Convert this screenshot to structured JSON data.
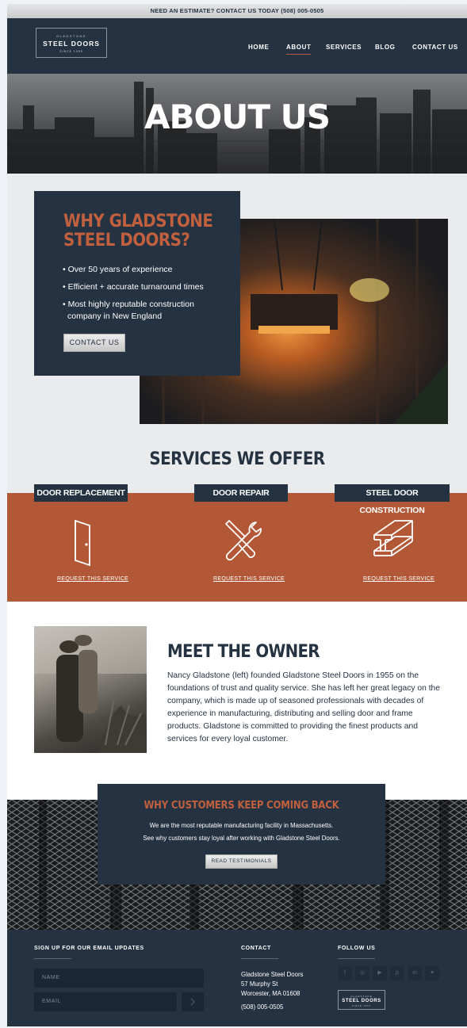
{
  "topbar": {
    "text": "NEED AN ESTIMATE? CONTACT US TODAY (508) 005-0505"
  },
  "logo": {
    "line1": "GLADSTONE",
    "line2": "STEEL DOORS",
    "line3": "SINCE 1955"
  },
  "nav": {
    "items": [
      "HOME",
      "ABOUT",
      "SERVICES",
      "BLOG",
      "CONTACT US"
    ],
    "active": "ABOUT"
  },
  "hero": {
    "title": "ABOUT US"
  },
  "why": {
    "title_line1": "WHY GLADSTONE",
    "title_line2": "STEEL DOORS?",
    "bullets": [
      "• Over 50 years of experience",
      "• Efficient + accurate turnaround times",
      "• Most highly reputable construction",
      "company in New England"
    ],
    "button": "CONTACT US"
  },
  "services": {
    "title": "SERVICES WE OFFER",
    "items": [
      {
        "name": "DOOR REPLACEMENT",
        "link": "REQUEST THIS SERVICE",
        "icon": "door-icon"
      },
      {
        "name": "DOOR REPAIR",
        "link": "REQUEST THIS SERVICE",
        "icon": "wrench-screwdriver-icon"
      },
      {
        "name": "STEEL DOOR CONSTRUCTION",
        "link": "REQUEST THIS SERVICE",
        "icon": "steel-beam-icon"
      }
    ]
  },
  "owner": {
    "title": "MEET THE OWNER",
    "text": "Nancy Gladstone (left) founded Gladstone Steel Doors in 1955 on the foundations of trust and quality service. She has left her great legacy on the company, which is made up of seasoned professionals with decades of experience in manufacturing, distributing and selling door and frame products. Gladstone is committed to providing the finest products and services for every loyal customer."
  },
  "testimonials": {
    "title": "WHY CUSTOMERS KEEP COMING BACK",
    "line1": "We are the most reputable manufacturing facility in Massachusetts.",
    "line2": "See why customers stay loyal after working with Gladstone Steel Doors.",
    "button": "READ TESTIMONIALS"
  },
  "footer": {
    "signup_heading": "SIGN UP FOR OUR EMAIL UPDATES",
    "name_placeholder": "NAME",
    "email_placeholder": "EMAIL",
    "contact_heading": "CONTACT",
    "company": "Gladstone Steel Doors",
    "street": "57 Murphy St",
    "city": "Worcester, MA 01608",
    "phone": "(508) 005-0505",
    "follow_heading": "FOLLOW US",
    "social_icons": [
      "facebook-icon",
      "instagram-icon",
      "youtube-icon",
      "pinterest-icon",
      "linkedin-icon",
      "twitter-icon"
    ],
    "social_glyphs": [
      "f",
      "◎",
      "▶",
      "p",
      "in",
      "✦"
    ]
  },
  "colors": {
    "navy": "#243241",
    "rust": "#b35837",
    "rust_text": "#c1603e",
    "light_bg": "#e9ebec"
  }
}
